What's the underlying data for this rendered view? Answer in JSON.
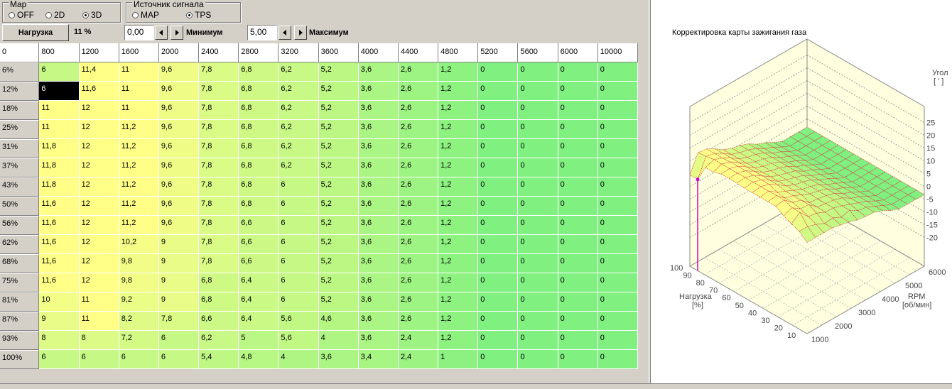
{
  "map_group": {
    "title": "Map",
    "options": [
      {
        "label": "OFF",
        "selected": false
      },
      {
        "label": "2D",
        "selected": false
      },
      {
        "label": "3D",
        "selected": true
      }
    ]
  },
  "source_group": {
    "title": "Источник сигнала",
    "options": [
      {
        "label": "MAP",
        "selected": false
      },
      {
        "label": "TPS",
        "selected": true
      }
    ]
  },
  "load": {
    "button_label": "Нагрузка",
    "value": "11 %"
  },
  "min": {
    "value": "0,00",
    "label": "Минимум"
  },
  "max": {
    "value": "5,00",
    "label": "Максимум"
  },
  "table": {
    "corner": "0",
    "columns": [
      "800",
      "1200",
      "1600",
      "2000",
      "2400",
      "2800",
      "3200",
      "3600",
      "4000",
      "4400",
      "4800",
      "5200",
      "5600",
      "6000",
      "10000"
    ],
    "rows": [
      {
        "label": "6%",
        "cells": [
          "6",
          "11,4",
          "11",
          "9,6",
          "7,8",
          "6,8",
          "6,2",
          "5,2",
          "3,6",
          "2,6",
          "1,2",
          "0",
          "0",
          "0",
          "0"
        ]
      },
      {
        "label": "12%",
        "cells": [
          "6",
          "11,6",
          "11",
          "9,6",
          "7,8",
          "6,8",
          "6,2",
          "5,2",
          "3,6",
          "2,6",
          "1,2",
          "0",
          "0",
          "0",
          "0"
        ]
      },
      {
        "label": "18%",
        "cells": [
          "11",
          "12",
          "11",
          "9,6",
          "7,8",
          "6,8",
          "6,2",
          "5,2",
          "3,6",
          "2,6",
          "1,2",
          "0",
          "0",
          "0",
          "0"
        ]
      },
      {
        "label": "25%",
        "cells": [
          "11",
          "12",
          "11,2",
          "9,6",
          "7,8",
          "6,8",
          "6,2",
          "5,2",
          "3,6",
          "2,6",
          "1,2",
          "0",
          "0",
          "0",
          "0"
        ]
      },
      {
        "label": "31%",
        "cells": [
          "11,8",
          "12",
          "11,2",
          "9,6",
          "7,8",
          "6,8",
          "6,2",
          "5,2",
          "3,6",
          "2,6",
          "1,2",
          "0",
          "0",
          "0",
          "0"
        ]
      },
      {
        "label": "37%",
        "cells": [
          "11,8",
          "12",
          "11,2",
          "9,6",
          "7,8",
          "6,8",
          "6,2",
          "5,2",
          "3,6",
          "2,6",
          "1,2",
          "0",
          "0",
          "0",
          "0"
        ]
      },
      {
        "label": "43%",
        "cells": [
          "11,8",
          "12",
          "11,2",
          "9,6",
          "7,8",
          "6,8",
          "6",
          "5,2",
          "3,6",
          "2,6",
          "1,2",
          "0",
          "0",
          "0",
          "0"
        ]
      },
      {
        "label": "50%",
        "cells": [
          "11,6",
          "12",
          "11,2",
          "9,6",
          "7,8",
          "6,8",
          "6",
          "5,2",
          "3,6",
          "2,6",
          "1,2",
          "0",
          "0",
          "0",
          "0"
        ]
      },
      {
        "label": "56%",
        "cells": [
          "11,6",
          "12",
          "11,2",
          "9,6",
          "7,8",
          "6,6",
          "6",
          "5,2",
          "3,6",
          "2,6",
          "1,2",
          "0",
          "0",
          "0",
          "0"
        ]
      },
      {
        "label": "62%",
        "cells": [
          "11,6",
          "12",
          "10,2",
          "9",
          "7,8",
          "6,6",
          "6",
          "5,2",
          "3,6",
          "2,6",
          "1,2",
          "0",
          "0",
          "0",
          "0"
        ]
      },
      {
        "label": "68%",
        "cells": [
          "11,6",
          "12",
          "9,8",
          "9",
          "7,8",
          "6,6",
          "6",
          "5,2",
          "3,6",
          "2,6",
          "1,2",
          "0",
          "0",
          "0",
          "0"
        ]
      },
      {
        "label": "75%",
        "cells": [
          "11,6",
          "12",
          "9,8",
          "9",
          "6,8",
          "6,4",
          "6",
          "5,2",
          "3,6",
          "2,6",
          "1,2",
          "0",
          "0",
          "0",
          "0"
        ]
      },
      {
        "label": "81%",
        "cells": [
          "10",
          "11",
          "9,2",
          "9",
          "6,8",
          "6,4",
          "6",
          "5,2",
          "3,6",
          "2,6",
          "1,2",
          "0",
          "0",
          "0",
          "0"
        ]
      },
      {
        "label": "87%",
        "cells": [
          "9",
          "11",
          "8,2",
          "7,8",
          "6,6",
          "6,4",
          "5,6",
          "4,6",
          "3,6",
          "2,6",
          "1,2",
          "0",
          "0",
          "0",
          "0"
        ]
      },
      {
        "label": "93%",
        "cells": [
          "8",
          "8",
          "7,2",
          "6",
          "6,2",
          "5",
          "5,6",
          "4",
          "3,6",
          "2,4",
          "1,2",
          "0",
          "0",
          "0",
          "0"
        ]
      },
      {
        "label": "100%",
        "cells": [
          "6",
          "6",
          "6",
          "6",
          "5,4",
          "4,8",
          "4",
          "3,6",
          "3,4",
          "2,4",
          "1",
          "0",
          "0",
          "0",
          "0"
        ]
      }
    ],
    "selected": {
      "row": 1,
      "col": 0
    },
    "colors": {
      "high": "#ffff88",
      "low": "#80f080"
    }
  },
  "chart": {
    "title": "Корректировка карты зажигания газа",
    "z_label": "Угол",
    "z_unit": "[ ' ]",
    "z_ticks": [
      "25",
      "20",
      "15",
      "10",
      "5",
      "0",
      "-5",
      "-10",
      "-15",
      "-20"
    ],
    "load_label": "Нагрузка",
    "load_unit": "[%]",
    "load_ticks": [
      "100",
      "90",
      "80",
      "70",
      "60",
      "50",
      "40",
      "30",
      "20",
      "10"
    ],
    "rpm_label": "RPM",
    "rpm_unit": "[об/мин]",
    "rpm_ticks": [
      "1000",
      "2000",
      "3000",
      "4000",
      "5000",
      "6000"
    ],
    "cursor_color": "#d000d0"
  }
}
